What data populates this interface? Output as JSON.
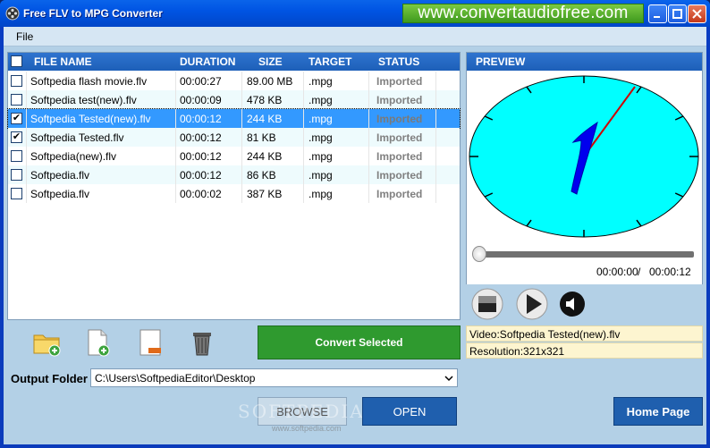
{
  "window": {
    "title": "Free FLV to MPG Converter",
    "banner": "www.convertaudiofree.com"
  },
  "menu": {
    "file": "File"
  },
  "list": {
    "headers": {
      "file_name": "FILE NAME",
      "duration": "DURATION",
      "size": "SIZE",
      "target": "TARGET",
      "status": "STATUS"
    },
    "rows": [
      {
        "checked": false,
        "name": "Softpedia flash movie.flv",
        "duration": "00:00:27",
        "size": "89.00 MB",
        "target": ".mpg",
        "status": "Imported"
      },
      {
        "checked": false,
        "name": "Softpedia test(new).flv",
        "duration": "00:00:09",
        "size": "478 KB",
        "target": ".mpg",
        "status": "Imported"
      },
      {
        "checked": true,
        "name": "Softpedia Tested(new).flv",
        "duration": "00:00:12",
        "size": "244 KB",
        "target": ".mpg",
        "status": "Imported"
      },
      {
        "checked": true,
        "name": "Softpedia Tested.flv",
        "duration": "00:00:12",
        "size": "81 KB",
        "target": ".mpg",
        "status": "Imported"
      },
      {
        "checked": false,
        "name": "Softpedia(new).flv",
        "duration": "00:00:12",
        "size": "244 KB",
        "target": ".mpg",
        "status": "Imported"
      },
      {
        "checked": false,
        "name": "Softpedia.flv",
        "duration": "00:00:12",
        "size": "86 KB",
        "target": ".mpg",
        "status": "Imported"
      },
      {
        "checked": false,
        "name": "Softpedia.flv",
        "duration": "00:00:02",
        "size": "387 KB",
        "target": ".mpg",
        "status": "Imported"
      }
    ]
  },
  "convert_button": "Convert Selected",
  "output": {
    "label": "Output Folder",
    "path": "C:\\Users\\SoftpediaEditor\\Desktop"
  },
  "buttons": {
    "browse": "BROWSE",
    "open": "OPEN",
    "home": "Home Page"
  },
  "watermark": {
    "text": "SOFTPEDIA",
    "url": "www.softpedia.com"
  },
  "preview": {
    "header": "PREVIEW",
    "current_time": "00:00:00",
    "separator": "/",
    "total_time": "00:00:12",
    "video_info": "Video:Softpedia Tested(new).flv",
    "resolution": "Resolution:321x321"
  },
  "colors": {
    "accent_blue": "#1d5fb8",
    "convert_green": "#2f9a2f",
    "clock_face": "#00ffff",
    "selected_row": "#3399ff"
  }
}
